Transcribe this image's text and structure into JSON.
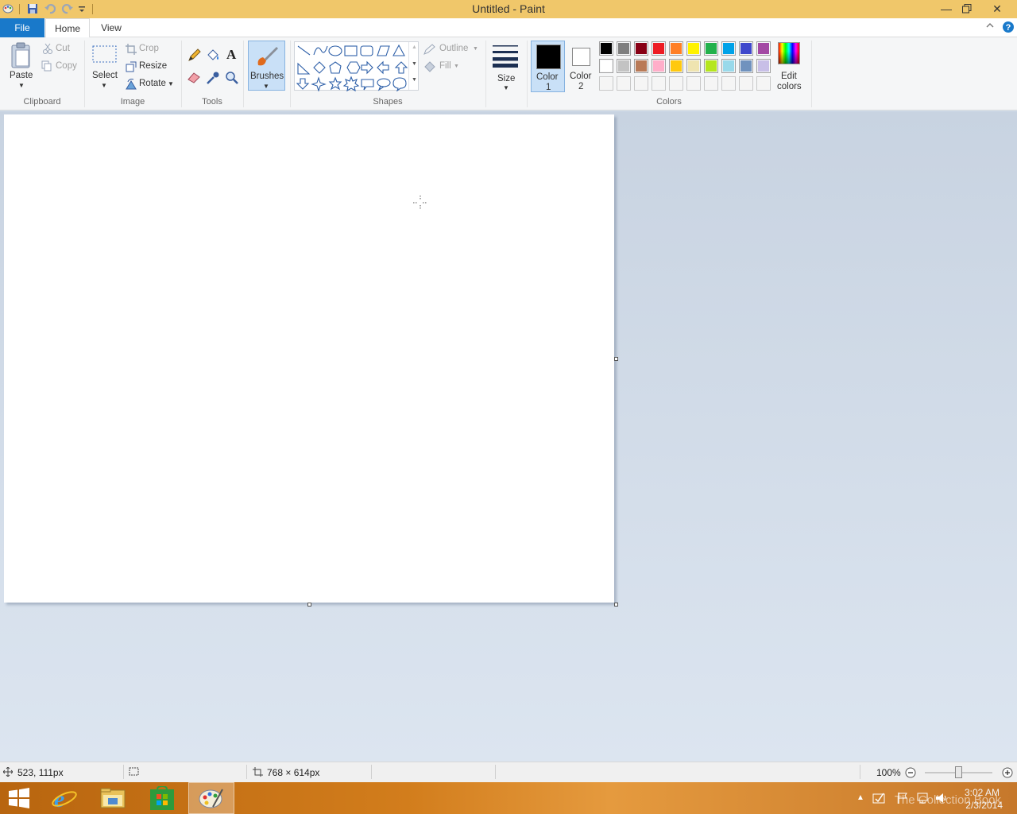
{
  "window": {
    "title": "Untitled - Paint"
  },
  "tabs": {
    "file": "File",
    "home": "Home",
    "view": "View"
  },
  "ribbon": {
    "clipboard": {
      "paste": "Paste",
      "cut": "Cut",
      "copy": "Copy",
      "group": "Clipboard"
    },
    "image": {
      "select": "Select",
      "crop": "Crop",
      "resize": "Resize",
      "rotate": "Rotate",
      "group": "Image"
    },
    "tools": {
      "group": "Tools"
    },
    "brushes": {
      "label": "Brushes"
    },
    "shapes": {
      "outline": "Outline",
      "fill": "Fill",
      "group": "Shapes"
    },
    "size": {
      "label": "Size"
    },
    "colors": {
      "color1_a": "Color",
      "color1_b": "1",
      "color2_a": "Color",
      "color2_b": "2",
      "edit_a": "Edit",
      "edit_b": "colors",
      "group": "Colors",
      "color1_value": "#000000",
      "color2_value": "#ffffff",
      "palette_row1": [
        "#000000",
        "#7f7f7f",
        "#880015",
        "#ed1c24",
        "#ff7f27",
        "#fff200",
        "#22b14c",
        "#00a2e8",
        "#3f48cc",
        "#a349a4"
      ],
      "palette_row2": [
        "#ffffff",
        "#c3c3c3",
        "#b97a57",
        "#ffaec9",
        "#ffc90e",
        "#efe4b0",
        "#b5e61d",
        "#99d9ea",
        "#7092be",
        "#c8bfe7"
      ],
      "palette_row3": [
        "#f5f5f5",
        "#f5f5f5",
        "#f5f5f5",
        "#f5f5f5",
        "#f5f5f5",
        "#f5f5f5",
        "#f5f5f5",
        "#f5f5f5",
        "#f5f5f5",
        "#f5f5f5"
      ]
    }
  },
  "status": {
    "cursor_pos": "523, 111px",
    "canvas_size": "768 × 614px",
    "zoom": "100%"
  },
  "taskbar": {
    "time": "3:02 AM",
    "date": "2/3/2014",
    "watermark": "The Collection Book"
  }
}
